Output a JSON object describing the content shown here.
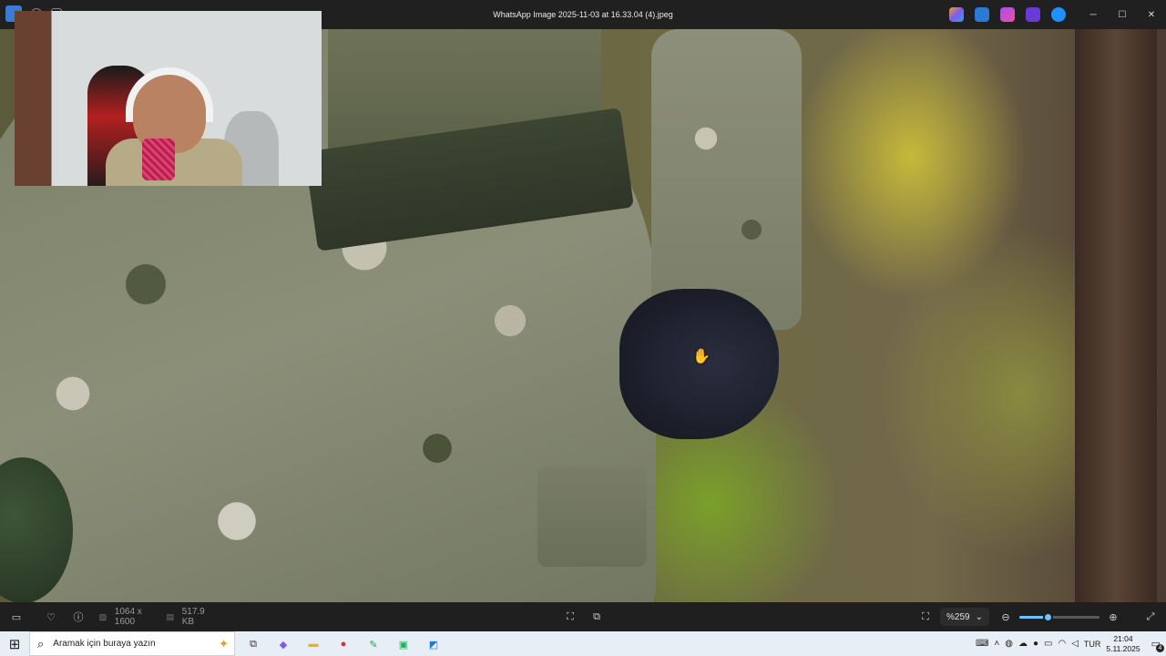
{
  "window": {
    "title": "WhatsApp Image 2025-11-03 at 16.33.04 (4).jpeg",
    "controls": {
      "minimize": "─",
      "maximize": "☐",
      "close": "✕"
    },
    "title_icons": [
      "gallery-icon",
      "search-icon",
      "settings-icon"
    ],
    "app_icons": [
      "copilot-icon",
      "photos-icon",
      "clipchamp-icon",
      "designer-icon",
      "onedrive-icon"
    ]
  },
  "viewer": {
    "image_info": {
      "dimensions": "1064 x 1600",
      "file_size": "517.9 KB"
    },
    "zoom": {
      "label": "%259",
      "level_fraction": 0.35
    },
    "icons": {
      "filmstrip": "▭",
      "favorite": "♡",
      "info": "ⓘ",
      "dimensions": "▨",
      "filesize": "▤",
      "fit": "⛶",
      "compare": "⧉",
      "actual_size": "⛶",
      "chevron": "⌄",
      "zoom_out": "⊖",
      "zoom_in": "⊕",
      "fullscreen": "⤢"
    }
  },
  "taskbar": {
    "search_placeholder": "Aramak için buraya yazın",
    "search_icon": "⌕",
    "start_icon": "⊞",
    "apps": [
      {
        "name": "task-view-icon",
        "glyph": "⧉",
        "color": "#333333"
      },
      {
        "name": "copilot-icon",
        "glyph": "◆",
        "color": "#7a5cf0"
      },
      {
        "name": "file-explorer-icon",
        "glyph": "▬",
        "color": "#e8b020"
      },
      {
        "name": "chrome-icon",
        "glyph": "●",
        "color": "#d93025"
      },
      {
        "name": "feather-app-icon",
        "glyph": "✎",
        "color": "#2a9d5a"
      },
      {
        "name": "android-app-icon",
        "glyph": "▣",
        "color": "#1db35b"
      },
      {
        "name": "photos-app-icon",
        "glyph": "◩",
        "color": "#1e7ad6"
      }
    ],
    "tray": {
      "language": "TUR",
      "time": "21:04",
      "date": "5.11.2025",
      "notification_count": "4"
    }
  }
}
